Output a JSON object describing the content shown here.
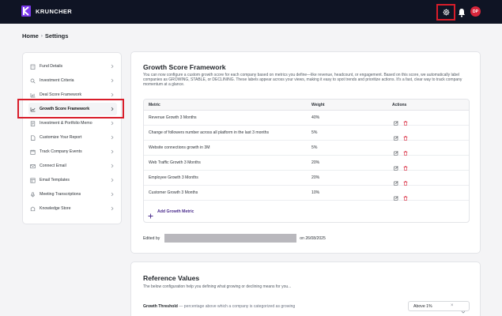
{
  "app": {
    "name": "KRUNCHER",
    "user_initials": "DP"
  },
  "breadcrumb": {
    "home": "Home",
    "current": "Settings"
  },
  "sidebar": {
    "items": [
      {
        "label": "Fund Details",
        "icon": "building-icon"
      },
      {
        "label": "Investment Criteria",
        "icon": "criteria-icon"
      },
      {
        "label": "Deal Score Framework",
        "icon": "score-icon"
      },
      {
        "label": "Growth Score Framework",
        "icon": "growth-chart-icon",
        "active": true
      },
      {
        "label": "Investment & Portfolio Memo",
        "icon": "memo-icon"
      },
      {
        "label": "Customize Your Report",
        "icon": "report-icon"
      },
      {
        "label": "Track Company Events",
        "icon": "events-icon"
      },
      {
        "label": "Connect Email",
        "icon": "mail-icon"
      },
      {
        "label": "Email Templates",
        "icon": "template-icon"
      },
      {
        "label": "Meeting Transcriptions",
        "icon": "transcription-icon"
      },
      {
        "label": "Knowledge Store",
        "icon": "knowledge-icon"
      }
    ]
  },
  "growth": {
    "title": "Growth Score Framework",
    "description": "You can now configure a custom growth score for each company based on metrics you define—like revenue, headcount, or engagement. Based on this score, we automatically label companies as GROWING, STABLE, or DECLINING. These labels appear across your views, making it easy to spot trends and prioritize actions. It's a fast, clear way to track company momentum at a glance.",
    "columns": {
      "metric": "Metric",
      "weight": "Weight",
      "actions": "Actions"
    },
    "rows": [
      {
        "metric": "Revenue Growth 3 Months",
        "weight": "40%"
      },
      {
        "metric": "Change of followers number across all platform in the last 3 months",
        "weight": "5%"
      },
      {
        "metric": "Website connections growth in 3M",
        "weight": "5%"
      },
      {
        "metric": "Web Traffic Growth 3 Months",
        "weight": "20%"
      },
      {
        "metric": "Employee Growth 3 Months",
        "weight": "20%"
      },
      {
        "metric": "Customer Growth 3 Months",
        "weight": "10%"
      }
    ],
    "add_label": "Add Growth Metric",
    "edited_prefix": "Edited by",
    "edited_suffix": "on 26/08/2025"
  },
  "reference": {
    "title": "Reference Values",
    "subtitle": "The below configuration help you defining what growing or declining means for you...",
    "threshold_label": "Growth Threshold",
    "threshold_hint": " — percentage above which a company is categorized as growing",
    "threshold_value": "Above 1%",
    "clear_glyph": "×"
  },
  "colors": {
    "topbar": "#0f1424",
    "accent": "#4a2b8c",
    "highlight": "#d81d2a",
    "avatar": "#d8263b"
  }
}
